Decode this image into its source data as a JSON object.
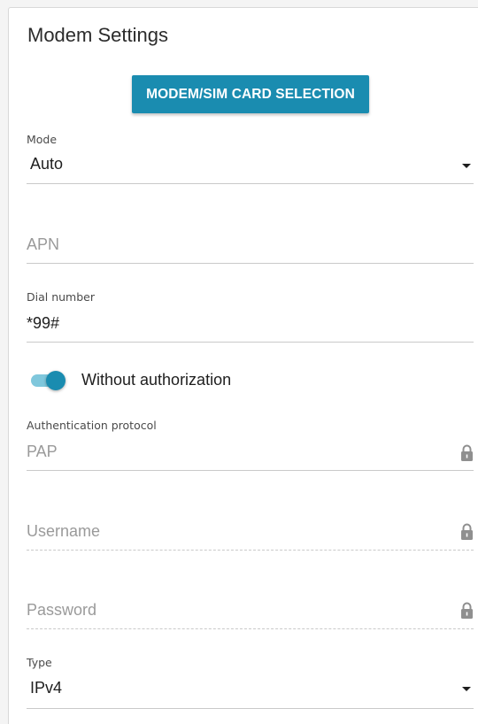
{
  "section": {
    "title": "Modem Settings"
  },
  "buttons": {
    "modem_sim_selection": "MODEM/SIM CARD SELECTION"
  },
  "fields": {
    "mode": {
      "label": "Mode",
      "value": "Auto"
    },
    "apn": {
      "placeholder": "APN",
      "value": ""
    },
    "dial_number": {
      "label": "Dial number",
      "value": "*99#"
    },
    "without_authorization": {
      "label": "Without authorization",
      "enabled": true
    },
    "auth_protocol": {
      "label": "Authentication protocol",
      "value": "PAP",
      "locked": true
    },
    "username": {
      "placeholder": "Username",
      "locked": true
    },
    "password": {
      "placeholder": "Password",
      "locked": true
    },
    "type": {
      "label": "Type",
      "value": "IPv4"
    }
  },
  "colors": {
    "accent": "#1a8cb0",
    "toggle_track": "#7fc7dc",
    "text": "#1e1e1e",
    "muted": "#9a9a9a",
    "line": "#c9c9c9"
  },
  "icons": {
    "dropdown": "caret-down-icon",
    "lock": "lock-icon"
  }
}
